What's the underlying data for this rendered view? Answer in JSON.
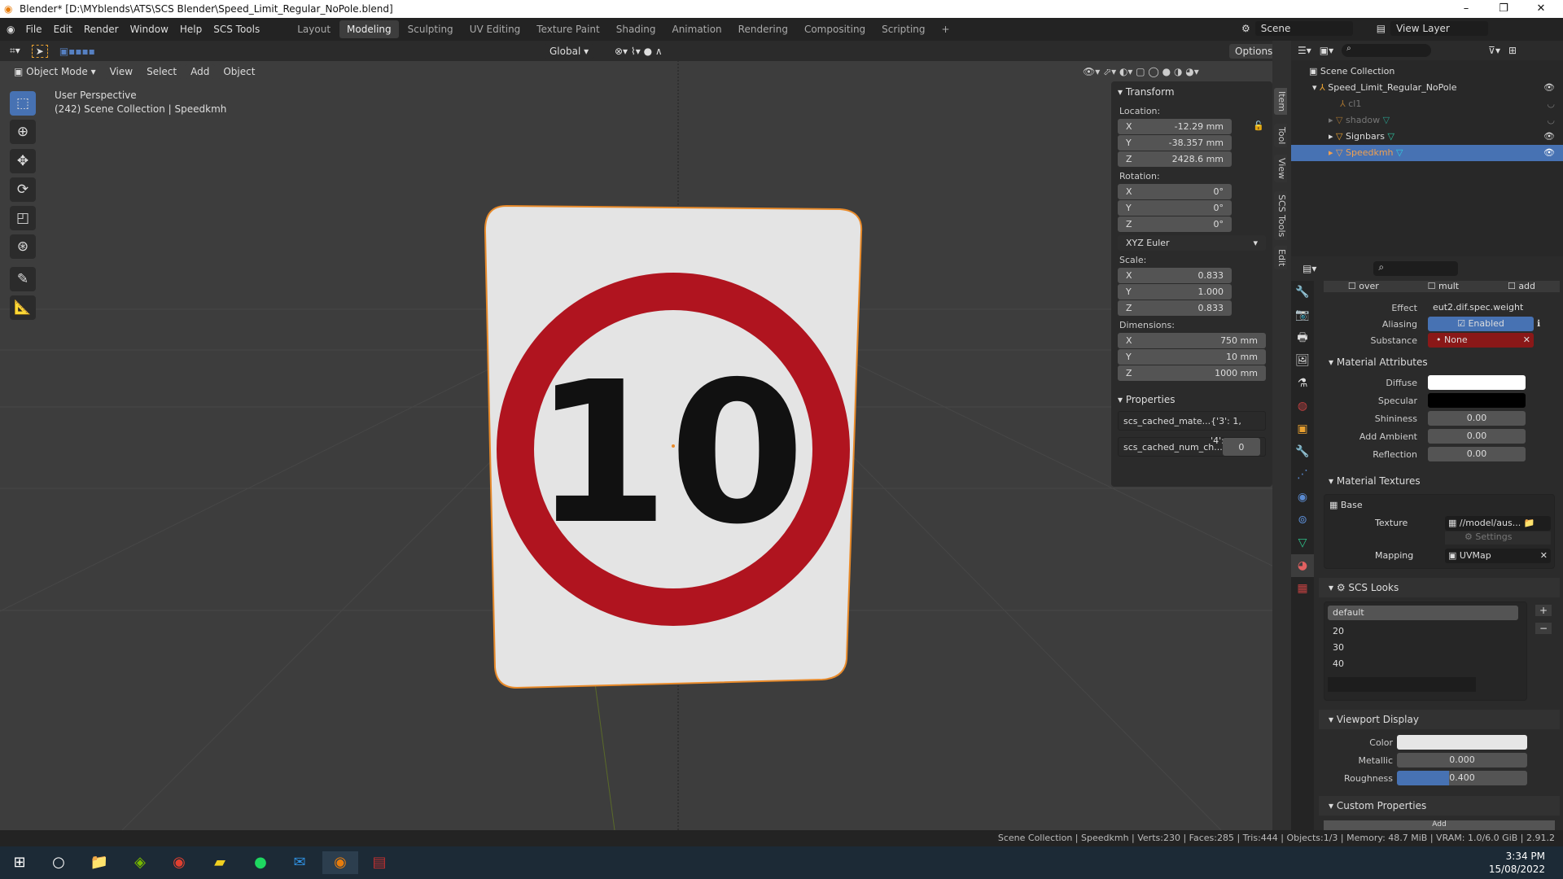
{
  "window": {
    "title": "Blender* [D:\\MYblends\\ATS\\SCS Blender\\Speed_Limit_Regular_NoPole.blend]"
  },
  "menu": [
    "File",
    "Edit",
    "Render",
    "Window",
    "Help",
    "SCS Tools"
  ],
  "workspaces": [
    "Layout",
    "Modeling",
    "Sculpting",
    "UV Editing",
    "Texture Paint",
    "Shading",
    "Animation",
    "Rendering",
    "Compositing",
    "Scripting"
  ],
  "active_workspace": "Modeling",
  "scene": "Scene",
  "view_layer": "View Layer",
  "toolbar": {
    "orientation": "Global",
    "options": "Options"
  },
  "viewport_header": {
    "mode": "Object Mode",
    "menus": [
      "View",
      "Select",
      "Add",
      "Object"
    ]
  },
  "viewport": {
    "perspective": "User Perspective",
    "info": "(242) Scene Collection | Speedkmh",
    "sign_text": "10",
    "sign_ring_color": "#b0141f"
  },
  "npanel": {
    "transform": "Transform",
    "location_label": "Location:",
    "location": [
      {
        "axis": "X",
        "value": "-12.29 mm"
      },
      {
        "axis": "Y",
        "value": "-38.357 mm"
      },
      {
        "axis": "Z",
        "value": "2428.6 mm"
      }
    ],
    "rotation_label": "Rotation:",
    "rotation": [
      {
        "axis": "X",
        "value": "0°"
      },
      {
        "axis": "Y",
        "value": "0°"
      },
      {
        "axis": "Z",
        "value": "0°"
      }
    ],
    "rotation_mode": "XYZ Euler",
    "scale_label": "Scale:",
    "scale": [
      {
        "axis": "X",
        "value": "0.833"
      },
      {
        "axis": "Y",
        "value": "1.000"
      },
      {
        "axis": "Z",
        "value": "0.833"
      }
    ],
    "dimensions_label": "Dimensions:",
    "dimensions": [
      {
        "axis": "X",
        "value": "750 mm"
      },
      {
        "axis": "Y",
        "value": "10 mm"
      },
      {
        "axis": "Z",
        "value": "1000 mm"
      }
    ],
    "properties": "Properties",
    "prop1_key": "scs_cached_mate...",
    "prop1_val": "{'3': 1, '4':...",
    "prop2_key": "scs_cached_num_ch...",
    "prop2_val": "0",
    "tabs": [
      "Item",
      "Tool",
      "View",
      "SCS Tools",
      "Edit"
    ]
  },
  "outliner": {
    "root": "Scene Collection",
    "items": [
      {
        "name": "Speed_Limit_Regular_NoPole"
      },
      {
        "name": "cl1"
      },
      {
        "name": "shadow"
      },
      {
        "name": "Signbars"
      },
      {
        "name": "Speedkmh"
      }
    ]
  },
  "properties": {
    "flags": [
      "over",
      "mult",
      "add"
    ],
    "effect_label": "Effect",
    "effect": "eut2.dif.spec.weight",
    "aliasing_label": "Aliasing",
    "aliasing": "Enabled",
    "substance_label": "Substance",
    "substance": "None",
    "mat_attr": "Material Attributes",
    "diffuse": "Diffuse",
    "specular": "Specular",
    "shininess": "Shininess",
    "shininess_v": "0.00",
    "ambient": "Add Ambient",
    "ambient_v": "0.00",
    "reflection": "Reflection",
    "reflection_v": "0.00",
    "mat_tex": "Material Textures",
    "base": "Base",
    "texture_label": "Texture",
    "texture": "//model/aus...",
    "settings": "Settings",
    "mapping_label": "Mapping",
    "mapping": "UVMap",
    "looks": "SCS Looks",
    "looks_items": [
      "default",
      "20",
      "30",
      "40"
    ],
    "viewport_display": "Viewport Display",
    "color": "Color",
    "metallic": "Metallic",
    "metallic_v": "0.000",
    "roughness": "Roughness",
    "roughness_v": "0.400",
    "roughness_fraction": 0.4,
    "custom": "Custom Properties",
    "add": "Add"
  },
  "status": "Scene Collection | Speedkmh | Verts:230 | Faces:285 | Tris:444 | Objects:1/3 | Memory: 48.7 MiB | VRAM: 1.0/6.0 GiB | 2.91.2",
  "taskbar": {
    "time": "3:34 PM",
    "date": "15/08/2022"
  }
}
